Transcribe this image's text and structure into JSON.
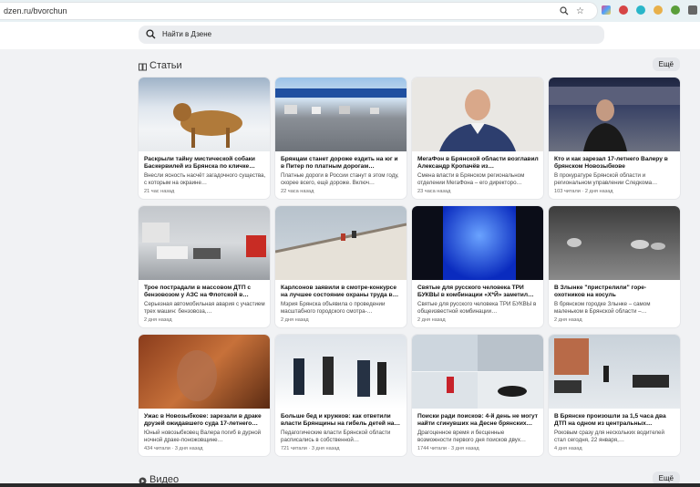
{
  "browser": {
    "url": "dzen.ru/bvorchun"
  },
  "search": {
    "placeholder": "Найти в Дзене"
  },
  "articles_section": {
    "title": "Статьи",
    "more_label": "Ещё"
  },
  "videos_section": {
    "title": "Видео",
    "more_label": "Ещё"
  },
  "cards": [
    {
      "title": "Раскрыли тайну мистической собаки Баскервилей из Брянска по кличке…",
      "snippet": "Внесли ясность насчёт загадочного существа, с которым на окраине…",
      "meta": "21 час назад"
    },
    {
      "title": "Брянцам станет дороже ездить на юг и в Питер по платным дорогам…",
      "snippet": "Платные дороги в России станут в этом году, скорее всего, ещё дороже. Включ…",
      "meta": "22 часа назад"
    },
    {
      "title": "МегаФон в Брянской области возглавил Александр Кропачёв из…",
      "snippet": "Смена власти в Брянском региональном отделении МегаФона – его директоро…",
      "meta": "23 часа назад"
    },
    {
      "title": "Кто и как зарезал 17-летнего Валеру в брянском Новозыбкове",
      "snippet": "В прокуратуре Брянской области и региональном управлении Следкома…",
      "meta": "103 читали · 2 дня назад"
    },
    {
      "title": "Трое пострадали в массовом ДТП с бензовозом у АЗС на Флотской в…",
      "snippet": "Серьезная автомобильная авария с участием трех машин: бензовоза,…",
      "meta": "2 дня назад"
    },
    {
      "title": "Карлсонов заявили в смотре-конкурсе на лучшее состояние охраны труда в…",
      "snippet": "Мэрия Брянска объявила о проведении масштабного городского смотра-…",
      "meta": "2 дня назад"
    },
    {
      "title": "Святые для русского человека ТРИ БУКВЫ в комбинации «Х*Й» заметил…",
      "snippet": "Святые для русского человека ТРИ БУКВЫ в общеизвестной комбинации…",
      "meta": "2 дня назад"
    },
    {
      "title": "В Злынке \"пристрелили\" горе-охотников на косуль",
      "snippet": "В брянском городке Злынке – самом маленьком в Брянской области –…",
      "meta": "2 дня назад"
    },
    {
      "title": "Ужас в Новозыбкове: зарезали в драке друзей ожидавшего суда 17-летнего…",
      "snippet": "Юный новозыбковец Валера погиб в дурной ночной драке-поножовщине…",
      "meta": "434 читали · 3 дня назад"
    },
    {
      "title": "Больше бед и кружков: как ответили власти Брянщины на гибель детей на…",
      "snippet": "Педагогические власти Брянской области расписались в собственной…",
      "meta": "721 читали · 3 дня назад"
    },
    {
      "title": "Поиски ради поисков: 4-й день не могут найти сгинувших на Десне брянских…",
      "snippet": "Драгоценное время и бесценные возможности первого дня поисков двух…",
      "meta": "1744 читали · 3 дня назад"
    },
    {
      "title": "В Брянске произошли за 1,5 часа два ДТП на одном из центральных…",
      "snippet": "Роковым сразу для нескольких водителей стал сегодня, 22 января,…",
      "meta": "4 дня назад"
    }
  ]
}
